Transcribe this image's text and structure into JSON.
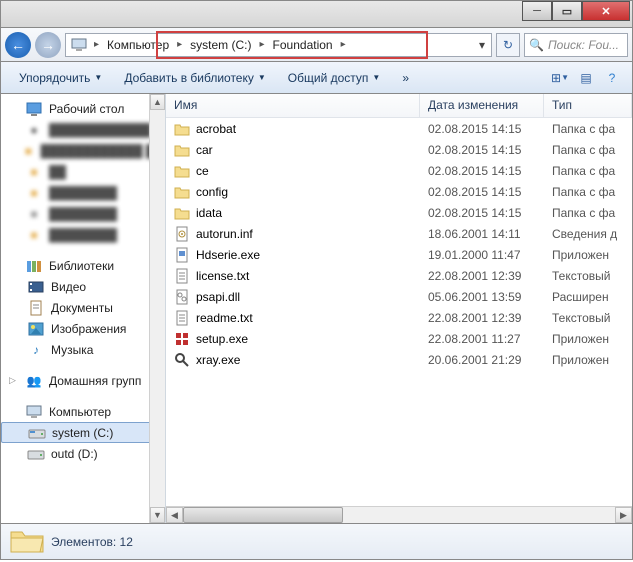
{
  "breadcrumb": {
    "segments": [
      "Компьютер",
      "system (C:)",
      "Foundation"
    ]
  },
  "search": {
    "placeholder": "Поиск: Fou..."
  },
  "toolbar": {
    "organize": "Упорядочить",
    "library": "Добавить в библиотеку",
    "share": "Общий доступ"
  },
  "sidebar": {
    "desktop": "Рабочий стол",
    "blur": [
      "████████████",
      "████████████ ██",
      "██",
      "████████",
      "████████",
      "████████"
    ],
    "libraries": "Библиотеки",
    "lib_items": [
      "Видео",
      "Документы",
      "Изображения",
      "Музыка"
    ],
    "homegroup": "Домашняя групп",
    "computer": "Компьютер",
    "drives": [
      "system (C:)",
      "outd (D:)"
    ]
  },
  "columns": {
    "name": "Имя",
    "date": "Дата изменения",
    "type": "Тип"
  },
  "files": [
    {
      "icon": "folder",
      "name": "acrobat",
      "date": "02.08.2015 14:15",
      "type": "Папка с фа"
    },
    {
      "icon": "folder",
      "name": "car",
      "date": "02.08.2015 14:15",
      "type": "Папка с фа"
    },
    {
      "icon": "folder",
      "name": "ce",
      "date": "02.08.2015 14:15",
      "type": "Папка с фа"
    },
    {
      "icon": "folder",
      "name": "config",
      "date": "02.08.2015 14:15",
      "type": "Папка с фа"
    },
    {
      "icon": "folder",
      "name": "idata",
      "date": "02.08.2015 14:15",
      "type": "Папка с фа"
    },
    {
      "icon": "inf",
      "name": "autorun.inf",
      "date": "18.06.2001 14:11",
      "type": "Сведения д"
    },
    {
      "icon": "exe",
      "name": "Hdserie.exe",
      "date": "19.01.2000 11:47",
      "type": "Приложен"
    },
    {
      "icon": "txt",
      "name": "license.txt",
      "date": "22.08.2001 12:39",
      "type": "Текстовый"
    },
    {
      "icon": "dll",
      "name": "psapi.dll",
      "date": "05.06.2001 13:59",
      "type": "Расширен"
    },
    {
      "icon": "txt",
      "name": "readme.txt",
      "date": "22.08.2001 12:39",
      "type": "Текстовый"
    },
    {
      "icon": "setup",
      "name": "setup.exe",
      "date": "22.08.2001 11:27",
      "type": "Приложен"
    },
    {
      "icon": "xray",
      "name": "xray.exe",
      "date": "20.06.2001 21:29",
      "type": "Приложен"
    }
  ],
  "status": {
    "count_label": "Элементов:",
    "count": "12"
  }
}
